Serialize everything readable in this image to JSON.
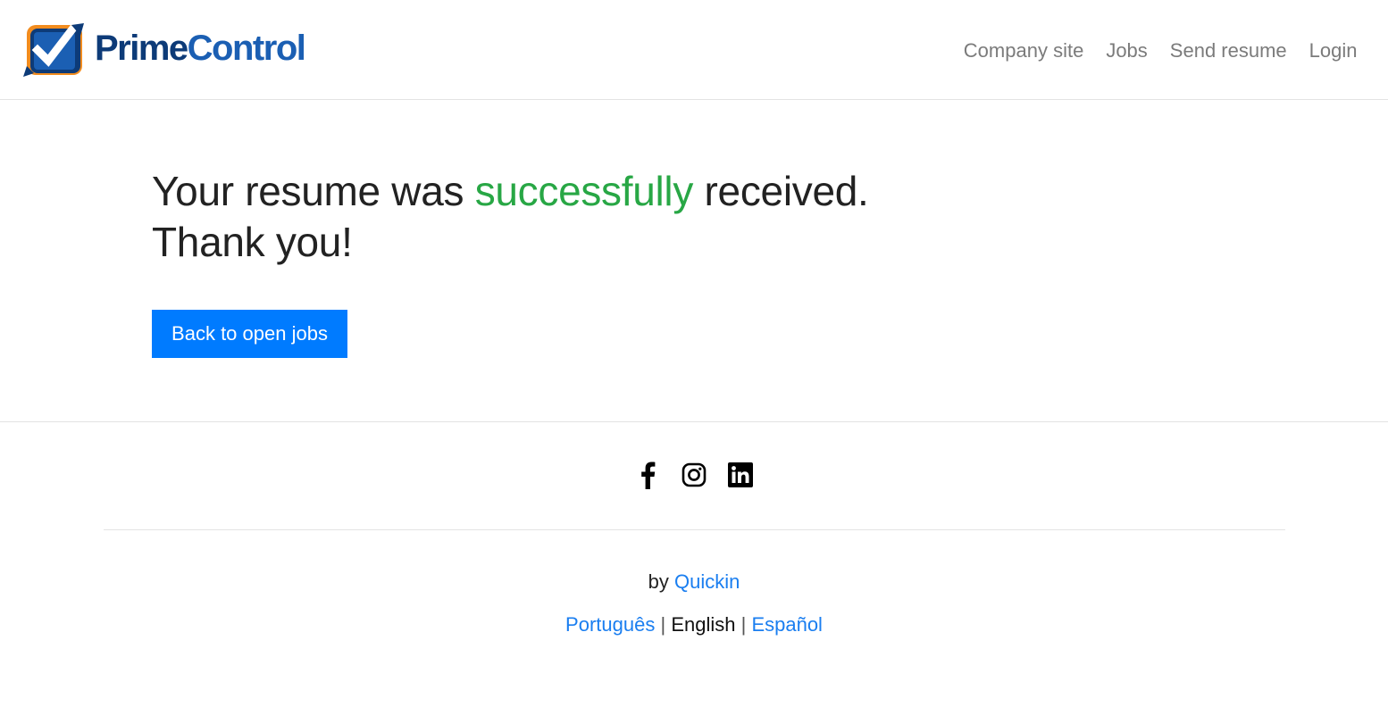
{
  "brand": {
    "name_bold": "Prime",
    "name_light": "Control"
  },
  "nav": {
    "items": [
      {
        "label": "Company site"
      },
      {
        "label": "Jobs"
      },
      {
        "label": "Send resume"
      },
      {
        "label": "Login"
      }
    ]
  },
  "main": {
    "message_part1": "Your resume was ",
    "message_highlight": "successfully",
    "message_part2": " received.",
    "message_line2": "Thank you!",
    "back_button": "Back to open jobs"
  },
  "footer": {
    "social_icons": [
      "facebook-icon",
      "instagram-icon",
      "linkedin-icon"
    ],
    "credit_prefix": "by ",
    "credit_link": "Quickin",
    "languages": [
      {
        "label": "Português",
        "active": false
      },
      {
        "label": "English",
        "active": true
      },
      {
        "label": "Español",
        "active": false
      }
    ],
    "language_separator": "|"
  },
  "colors": {
    "accent": "#007bff",
    "success": "#28a745",
    "link": "#1a7ef0",
    "brand": "#0d3b78",
    "logo_orange": "#f28c1e"
  }
}
